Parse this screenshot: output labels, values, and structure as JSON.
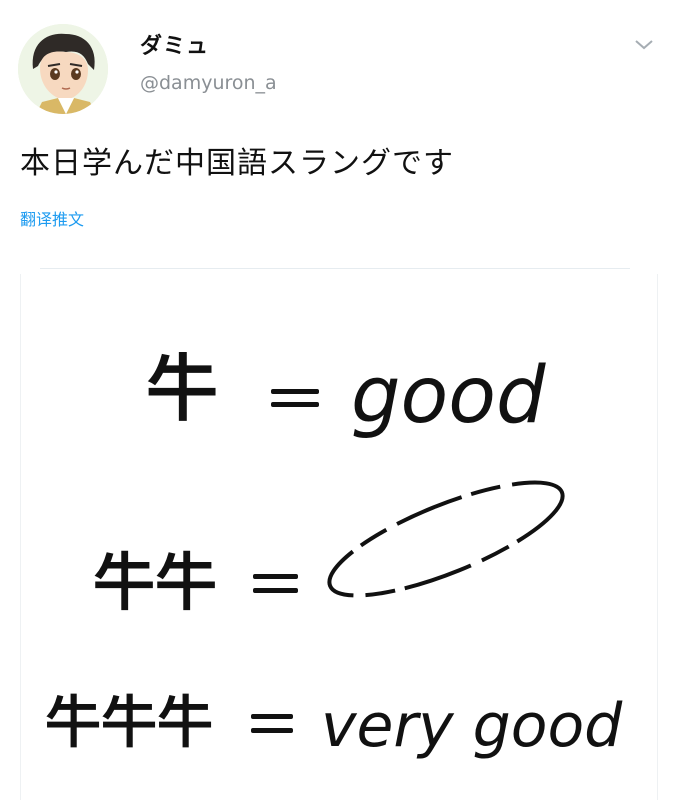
{
  "author": {
    "name": "ダミュ",
    "handle": "@damyuron_a"
  },
  "tweet": {
    "text": "本日学んだ中国語スラングです",
    "translate_label": "翻译推文"
  },
  "image": {
    "rows": [
      {
        "left": "牛",
        "right": "good"
      },
      {
        "left": "牛牛",
        "right": ""
      },
      {
        "left": "牛牛牛",
        "right": "very good"
      }
    ]
  },
  "icons": {
    "avatar": "avatar-anime-boy",
    "menu": "chevron-down-icon"
  }
}
